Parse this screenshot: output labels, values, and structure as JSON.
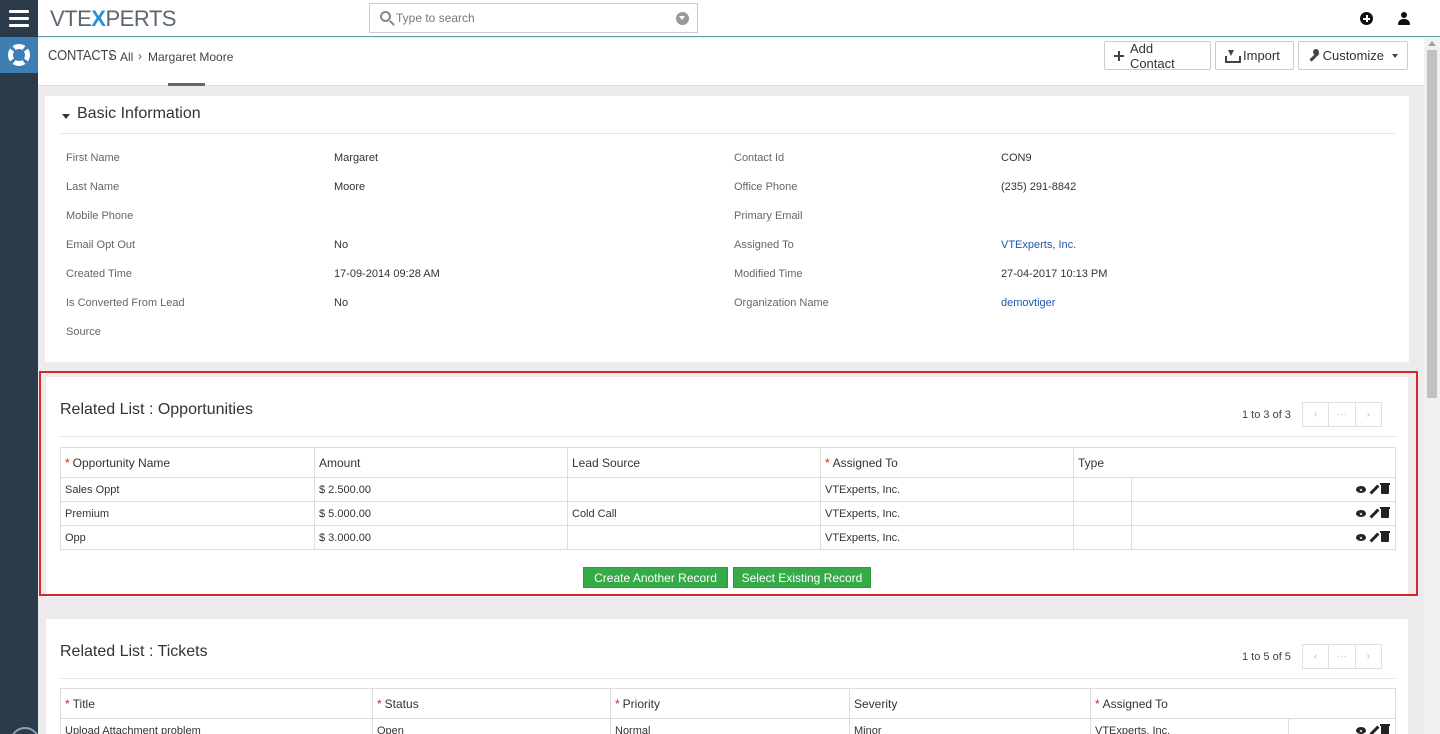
{
  "app": {
    "logo_prefix": "VTE",
    "logo_x": "X",
    "logo_suffix": "PERTS"
  },
  "search": {
    "placeholder": "Type to search"
  },
  "breadcrumb": {
    "module": "CONTACTS",
    "filter": "All",
    "record": "Margaret Moore"
  },
  "header_buttons": {
    "add_contact": "Add Contact",
    "import": "Import",
    "customize": "Customize"
  },
  "basic_info": {
    "title": "Basic Information",
    "left": [
      {
        "label": "First Name",
        "value": "Margaret"
      },
      {
        "label": "Last Name",
        "value": "Moore"
      },
      {
        "label": "Mobile Phone",
        "value": ""
      },
      {
        "label": "Email Opt Out",
        "value": "No"
      },
      {
        "label": "Created Time",
        "value": "17-09-2014 09:28 AM"
      },
      {
        "label": "Is Converted From Lead",
        "value": "No"
      },
      {
        "label": "Source",
        "value": ""
      }
    ],
    "right": [
      {
        "label": "Contact Id",
        "value": "CON9"
      },
      {
        "label": "Office Phone",
        "value": "(235) 291-8842"
      },
      {
        "label": "Primary Email",
        "value": ""
      },
      {
        "label": "Assigned To",
        "value": "VTExperts, Inc."
      },
      {
        "label": "Modified Time",
        "value": "27-04-2017 10:13 PM"
      },
      {
        "label": "Organization Name",
        "value": "demovtiger"
      }
    ]
  },
  "opportunities": {
    "title": "Related List : Opportunities",
    "pager": "1 to 3 of 3",
    "columns": [
      "Opportunity Name",
      "Amount",
      "Lead Source",
      "Assigned To",
      "Type"
    ],
    "rows": [
      {
        "name": "Sales Oppt",
        "amount": "$ 2.500.00",
        "lead_source": "",
        "assigned": "VTExperts, Inc.",
        "type": ""
      },
      {
        "name": "Premium",
        "amount": "$ 5.000.00",
        "lead_source": "Cold Call",
        "assigned": "VTExperts, Inc.",
        "type": ""
      },
      {
        "name": "Opp",
        "amount": "$ 3.000.00",
        "lead_source": "",
        "assigned": "VTExperts, Inc.",
        "type": ""
      }
    ],
    "create_button": "Create Another Record",
    "select_button": "Select Existing Record"
  },
  "tickets": {
    "title": "Related List : Tickets",
    "pager": "1 to 5 of 5",
    "columns": [
      "Title",
      "Status",
      "Priority",
      "Severity",
      "Assigned To"
    ],
    "rows": [
      {
        "title": "Upload Attachment problem",
        "status": "Open",
        "priority": "Normal",
        "severity": "Minor",
        "assigned": "VTExperts, Inc."
      }
    ]
  },
  "colors": {
    "rail": "#2c3b49",
    "rail_active": "#3d7fb5",
    "green_button": "#35aa47",
    "highlight_border": "#d9262b",
    "link": "#2255aa"
  },
  "icons": {
    "menu": "hamburger-icon",
    "rail_active": "lifebuoy-icon",
    "search": "search-icon",
    "add": "plus-icon",
    "import": "import-icon",
    "customize": "wrench-icon",
    "quick_create": "plus-circle-icon",
    "user": "user-icon",
    "row_view": "eye-icon",
    "row_edit": "pencil-icon",
    "row_delete": "trash-icon"
  }
}
